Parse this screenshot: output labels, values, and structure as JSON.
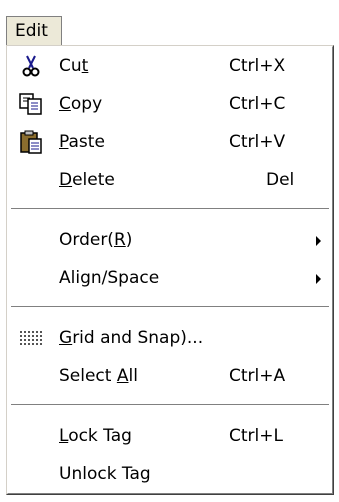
{
  "menubar": {
    "title": "Edit"
  },
  "menu": {
    "cut": {
      "pre": "Cu",
      "mn": "t",
      "post": "",
      "shortcut": "Ctrl+X",
      "icon": "scissors-icon"
    },
    "copy": {
      "pre": "",
      "mn": "C",
      "post": "opy",
      "shortcut": "Ctrl+C",
      "icon": "copy-icon"
    },
    "paste": {
      "pre": "",
      "mn": "P",
      "post": "aste",
      "shortcut": "Ctrl+V",
      "icon": "paste-icon"
    },
    "delete": {
      "pre": "",
      "mn": "D",
      "post": "elete",
      "shortcut": "Del"
    },
    "order": {
      "pre": "Order(",
      "mn": "R",
      "post": ")",
      "submenu": true
    },
    "align": {
      "pre": "Align/Space",
      "mn": "",
      "post": "",
      "submenu": true
    },
    "grid": {
      "pre": "",
      "mn": "G",
      "post": "rid and Snap)...",
      "icon": "grid-icon"
    },
    "select_all": {
      "pre": "Select ",
      "mn": "A",
      "post": "ll",
      "shortcut": "Ctrl+A"
    },
    "lock": {
      "pre": "",
      "mn": "L",
      "post": "ock Tag",
      "shortcut": "Ctrl+L"
    },
    "unlock": {
      "pre": "Unlock Tag",
      "mn": "",
      "post": ""
    }
  }
}
